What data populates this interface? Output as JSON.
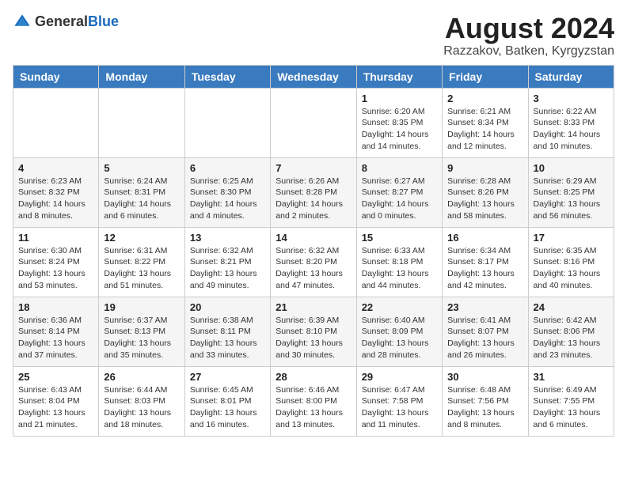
{
  "logo": {
    "general": "General",
    "blue": "Blue"
  },
  "title": {
    "month_year": "August 2024",
    "location": "Razzakov, Batken, Kyrgyzstan"
  },
  "days_of_week": [
    "Sunday",
    "Monday",
    "Tuesday",
    "Wednesday",
    "Thursday",
    "Friday",
    "Saturday"
  ],
  "weeks": [
    [
      {
        "day": "",
        "info": ""
      },
      {
        "day": "",
        "info": ""
      },
      {
        "day": "",
        "info": ""
      },
      {
        "day": "",
        "info": ""
      },
      {
        "day": "1",
        "info": "Sunrise: 6:20 AM\nSunset: 8:35 PM\nDaylight: 14 hours and 14 minutes."
      },
      {
        "day": "2",
        "info": "Sunrise: 6:21 AM\nSunset: 8:34 PM\nDaylight: 14 hours and 12 minutes."
      },
      {
        "day": "3",
        "info": "Sunrise: 6:22 AM\nSunset: 8:33 PM\nDaylight: 14 hours and 10 minutes."
      }
    ],
    [
      {
        "day": "4",
        "info": "Sunrise: 6:23 AM\nSunset: 8:32 PM\nDaylight: 14 hours and 8 minutes."
      },
      {
        "day": "5",
        "info": "Sunrise: 6:24 AM\nSunset: 8:31 PM\nDaylight: 14 hours and 6 minutes."
      },
      {
        "day": "6",
        "info": "Sunrise: 6:25 AM\nSunset: 8:30 PM\nDaylight: 14 hours and 4 minutes."
      },
      {
        "day": "7",
        "info": "Sunrise: 6:26 AM\nSunset: 8:28 PM\nDaylight: 14 hours and 2 minutes."
      },
      {
        "day": "8",
        "info": "Sunrise: 6:27 AM\nSunset: 8:27 PM\nDaylight: 14 hours and 0 minutes."
      },
      {
        "day": "9",
        "info": "Sunrise: 6:28 AM\nSunset: 8:26 PM\nDaylight: 13 hours and 58 minutes."
      },
      {
        "day": "10",
        "info": "Sunrise: 6:29 AM\nSunset: 8:25 PM\nDaylight: 13 hours and 56 minutes."
      }
    ],
    [
      {
        "day": "11",
        "info": "Sunrise: 6:30 AM\nSunset: 8:24 PM\nDaylight: 13 hours and 53 minutes."
      },
      {
        "day": "12",
        "info": "Sunrise: 6:31 AM\nSunset: 8:22 PM\nDaylight: 13 hours and 51 minutes."
      },
      {
        "day": "13",
        "info": "Sunrise: 6:32 AM\nSunset: 8:21 PM\nDaylight: 13 hours and 49 minutes."
      },
      {
        "day": "14",
        "info": "Sunrise: 6:32 AM\nSunset: 8:20 PM\nDaylight: 13 hours and 47 minutes."
      },
      {
        "day": "15",
        "info": "Sunrise: 6:33 AM\nSunset: 8:18 PM\nDaylight: 13 hours and 44 minutes."
      },
      {
        "day": "16",
        "info": "Sunrise: 6:34 AM\nSunset: 8:17 PM\nDaylight: 13 hours and 42 minutes."
      },
      {
        "day": "17",
        "info": "Sunrise: 6:35 AM\nSunset: 8:16 PM\nDaylight: 13 hours and 40 minutes."
      }
    ],
    [
      {
        "day": "18",
        "info": "Sunrise: 6:36 AM\nSunset: 8:14 PM\nDaylight: 13 hours and 37 minutes."
      },
      {
        "day": "19",
        "info": "Sunrise: 6:37 AM\nSunset: 8:13 PM\nDaylight: 13 hours and 35 minutes."
      },
      {
        "day": "20",
        "info": "Sunrise: 6:38 AM\nSunset: 8:11 PM\nDaylight: 13 hours and 33 minutes."
      },
      {
        "day": "21",
        "info": "Sunrise: 6:39 AM\nSunset: 8:10 PM\nDaylight: 13 hours and 30 minutes."
      },
      {
        "day": "22",
        "info": "Sunrise: 6:40 AM\nSunset: 8:09 PM\nDaylight: 13 hours and 28 minutes."
      },
      {
        "day": "23",
        "info": "Sunrise: 6:41 AM\nSunset: 8:07 PM\nDaylight: 13 hours and 26 minutes."
      },
      {
        "day": "24",
        "info": "Sunrise: 6:42 AM\nSunset: 8:06 PM\nDaylight: 13 hours and 23 minutes."
      }
    ],
    [
      {
        "day": "25",
        "info": "Sunrise: 6:43 AM\nSunset: 8:04 PM\nDaylight: 13 hours and 21 minutes."
      },
      {
        "day": "26",
        "info": "Sunrise: 6:44 AM\nSunset: 8:03 PM\nDaylight: 13 hours and 18 minutes."
      },
      {
        "day": "27",
        "info": "Sunrise: 6:45 AM\nSunset: 8:01 PM\nDaylight: 13 hours and 16 minutes."
      },
      {
        "day": "28",
        "info": "Sunrise: 6:46 AM\nSunset: 8:00 PM\nDaylight: 13 hours and 13 minutes."
      },
      {
        "day": "29",
        "info": "Sunrise: 6:47 AM\nSunset: 7:58 PM\nDaylight: 13 hours and 11 minutes."
      },
      {
        "day": "30",
        "info": "Sunrise: 6:48 AM\nSunset: 7:56 PM\nDaylight: 13 hours and 8 minutes."
      },
      {
        "day": "31",
        "info": "Sunrise: 6:49 AM\nSunset: 7:55 PM\nDaylight: 13 hours and 6 minutes."
      }
    ]
  ]
}
